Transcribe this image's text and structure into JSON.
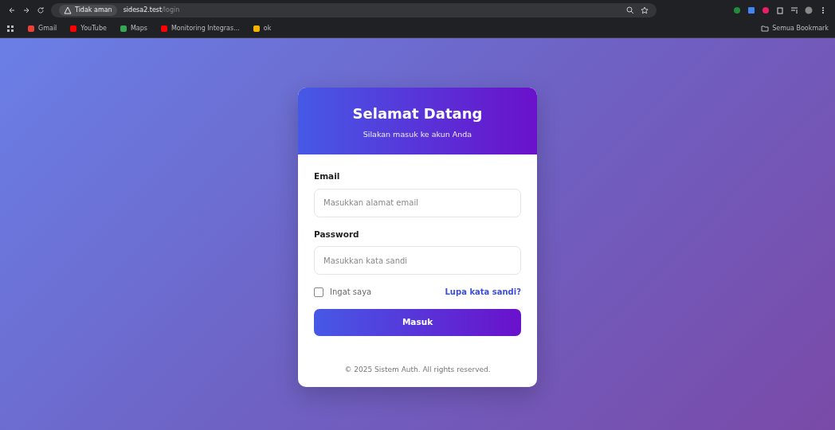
{
  "browser": {
    "security": "Tidak aman",
    "url_host": "sidesa2.test",
    "url_path": "/login",
    "bookmarks": [
      {
        "label": "Gmail",
        "color": "#ea4335"
      },
      {
        "label": "YouTube",
        "color": "#ff0000"
      },
      {
        "label": "Maps",
        "color": "#34a853"
      },
      {
        "label": "Monitoring Integras...",
        "color": "#ff0000"
      },
      {
        "label": "ok",
        "color": "#f4b400"
      }
    ],
    "all_bookmarks": "Semua Bookmark"
  },
  "login": {
    "title": "Selamat Datang",
    "subtitle": "Silakan masuk ke akun Anda",
    "fields": [
      {
        "label": "Email",
        "placeholder": "Masukkan alamat email"
      },
      {
        "label": "Password",
        "placeholder": "Masukkan kata sandi"
      }
    ],
    "remember": {
      "label": "Ingat saya",
      "checked": false
    },
    "forgot": "Lupa kata sandi?",
    "submit": "Masuk",
    "footer": "© 2025 Sistem Auth. All rights reserved."
  }
}
